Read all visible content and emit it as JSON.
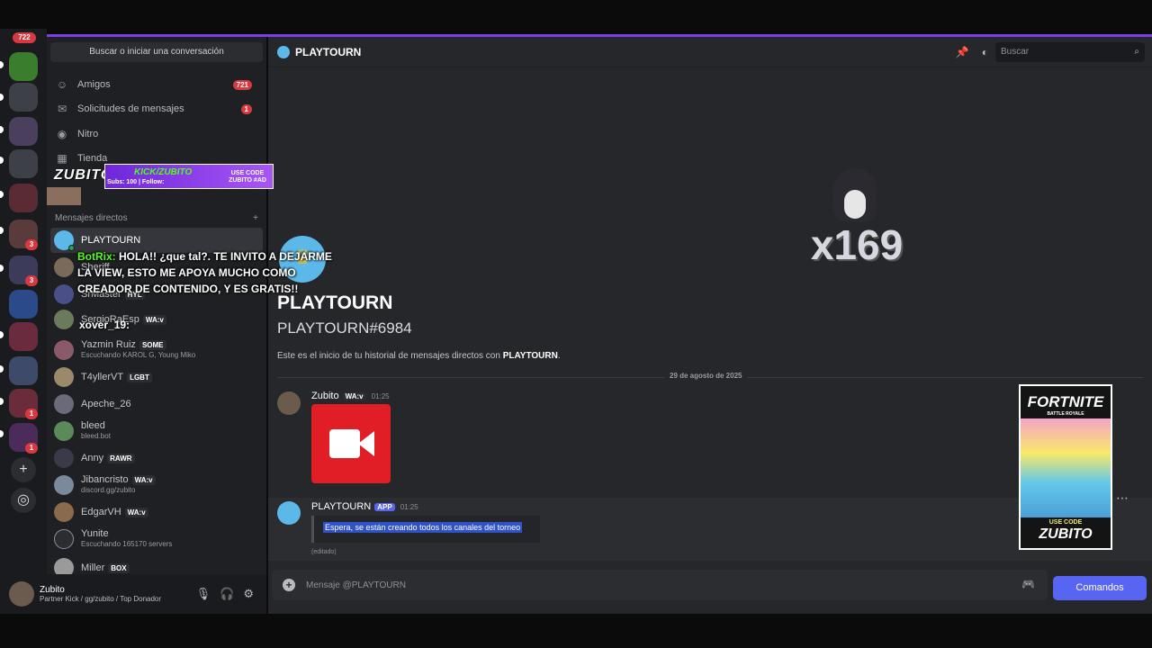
{
  "rail": {
    "top_badge": "722",
    "badges": [
      "3",
      "3",
      "1",
      "1"
    ]
  },
  "sidebar": {
    "search_label": "Buscar o iniciar una conversación",
    "nav": [
      {
        "label": "Amigos",
        "count": "721"
      },
      {
        "label": "Solicitudes de mensajes",
        "count": "1"
      },
      {
        "label": "Nitro",
        "count": ""
      },
      {
        "label": "Tienda",
        "count": ""
      }
    ],
    "dm_header": "Mensajes directos",
    "dm_add": "+",
    "dms": [
      {
        "name": "PLAYTOURN",
        "tag": "",
        "sub": "",
        "color": "#5bb8e8"
      },
      {
        "name": "Sheriff",
        "tag": "",
        "sub": "",
        "color": "#7a6a5a"
      },
      {
        "name": "SrMaster",
        "tag": "HYL",
        "sub": "",
        "color": "#4a4f8a"
      },
      {
        "name": "SergioRaEsp",
        "tag": "WA:v",
        "sub": "",
        "color": "#6a7a5a"
      },
      {
        "name": "Yazmin Ruiz",
        "tag": "SOME",
        "sub": "Escuchando KAROL G, Young Miko",
        "color": "#8a5a6a"
      },
      {
        "name": "T4yllerVT",
        "tag": "LGBT",
        "sub": "",
        "color": "#9a8a6a"
      },
      {
        "name": "Apeche_26",
        "tag": "",
        "sub": "",
        "color": "#6a6a7a"
      },
      {
        "name": "bleed",
        "tag": "",
        "sub": "bleed.bot",
        "color": "#5a8a5a"
      },
      {
        "name": "Anny",
        "tag": "RAWR",
        "sub": "",
        "color": "#3a3a4a"
      },
      {
        "name": "Jibancristo",
        "tag": "WA:v",
        "sub": "discord.gg/zubito",
        "color": "#7a8a9a"
      },
      {
        "name": "EdgarVH",
        "tag": "WA:v",
        "sub": "",
        "color": "#8a6a4a"
      },
      {
        "name": "Yunite",
        "tag": "",
        "sub": "Escuchando 165170 servers",
        "color": "#2b2d31"
      },
      {
        "name": "Miller",
        "tag": "BOX",
        "sub": "",
        "color": "#9a9a9a"
      }
    ]
  },
  "user": {
    "name": "Zubito",
    "status": "Partner Kick / gg/zubito / Top Donador"
  },
  "overlay": {
    "logo": "ZUBITO",
    "kick_label": "KICK/ZUBITO",
    "subs_label": "Subs: 100 | Follow:",
    "code_label": "USE CODE ZUBITO #AD",
    "chat_prefix": "BotRix:",
    "chat_message": "HOLA!! ¿que tal?. TE INVITO A DEJARME LA VIEW, ESTO ME APOYA MUCHO COMO CREADOR DE CONTENIDO, Y ES GRATIS!!",
    "chat_line2": "xover_19:"
  },
  "channel": {
    "title": "PLAYTOURN",
    "search_placeholder": "Buscar",
    "big_text": "x169",
    "welcome_name": "PLAYTOURN",
    "welcome_tag": "PLAYTOURN#6984",
    "welcome_prefix": "Este es el inicio de tu historial de mensajes directos con ",
    "welcome_bold": "PLAYTOURN",
    "welcome_suffix": ".",
    "date_divider": "29 de agosto de 2025"
  },
  "messages": [
    {
      "author": "Zubito",
      "tag": "WA:v",
      "time": "01:25"
    },
    {
      "author": "PLAYTOURN",
      "app_tag": "APP",
      "time": "01:25",
      "embed_text": "Espera, se están creando todos los canales del torneo",
      "edited": "(editado)"
    }
  ],
  "ad": {
    "title": "FORTNITE",
    "subtitle": "BATTLE ROYALE",
    "use_code": "USE CODE",
    "code": "ZUBITO"
  },
  "composer": {
    "placeholder": "Mensaje @PLAYTOURN",
    "commands_label": "Comandos"
  }
}
